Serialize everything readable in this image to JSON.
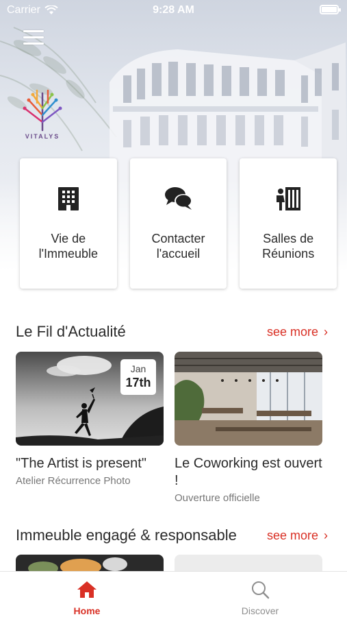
{
  "status_bar": {
    "carrier": "Carrier",
    "time": "9:28 AM"
  },
  "brand": {
    "logo_text": "VITALYS"
  },
  "tiles": [
    {
      "icon": "building-icon",
      "label": "Vie de l'Immeuble"
    },
    {
      "icon": "chat-bubbles-icon",
      "label": "Contacter l'accueil"
    },
    {
      "icon": "meeting-room-icon",
      "label": "Salles de Réunions"
    }
  ],
  "news": {
    "title": "Le Fil d'Actualité",
    "see_more": "see more",
    "cards": [
      {
        "title": "\"The Artist is present\"",
        "subtitle": "Atelier Récurrence Photo",
        "date_month": "Jan",
        "date_day": "17th"
      },
      {
        "title": "Le Coworking est ouvert !",
        "subtitle": "Ouverture officielle"
      }
    ]
  },
  "engaged": {
    "title": "Immeuble engagé & responsable",
    "see_more": "see more"
  },
  "tabbar": {
    "items": [
      {
        "label": "Home",
        "icon": "home-icon",
        "active": true
      },
      {
        "label": "Discover",
        "icon": "search-icon",
        "active": false
      }
    ],
    "active_color": "#d93025",
    "inactive_color": "#8e8e8e"
  },
  "colors": {
    "accent": "#d93025",
    "text": "#2b2b2b",
    "muted": "#777777"
  }
}
